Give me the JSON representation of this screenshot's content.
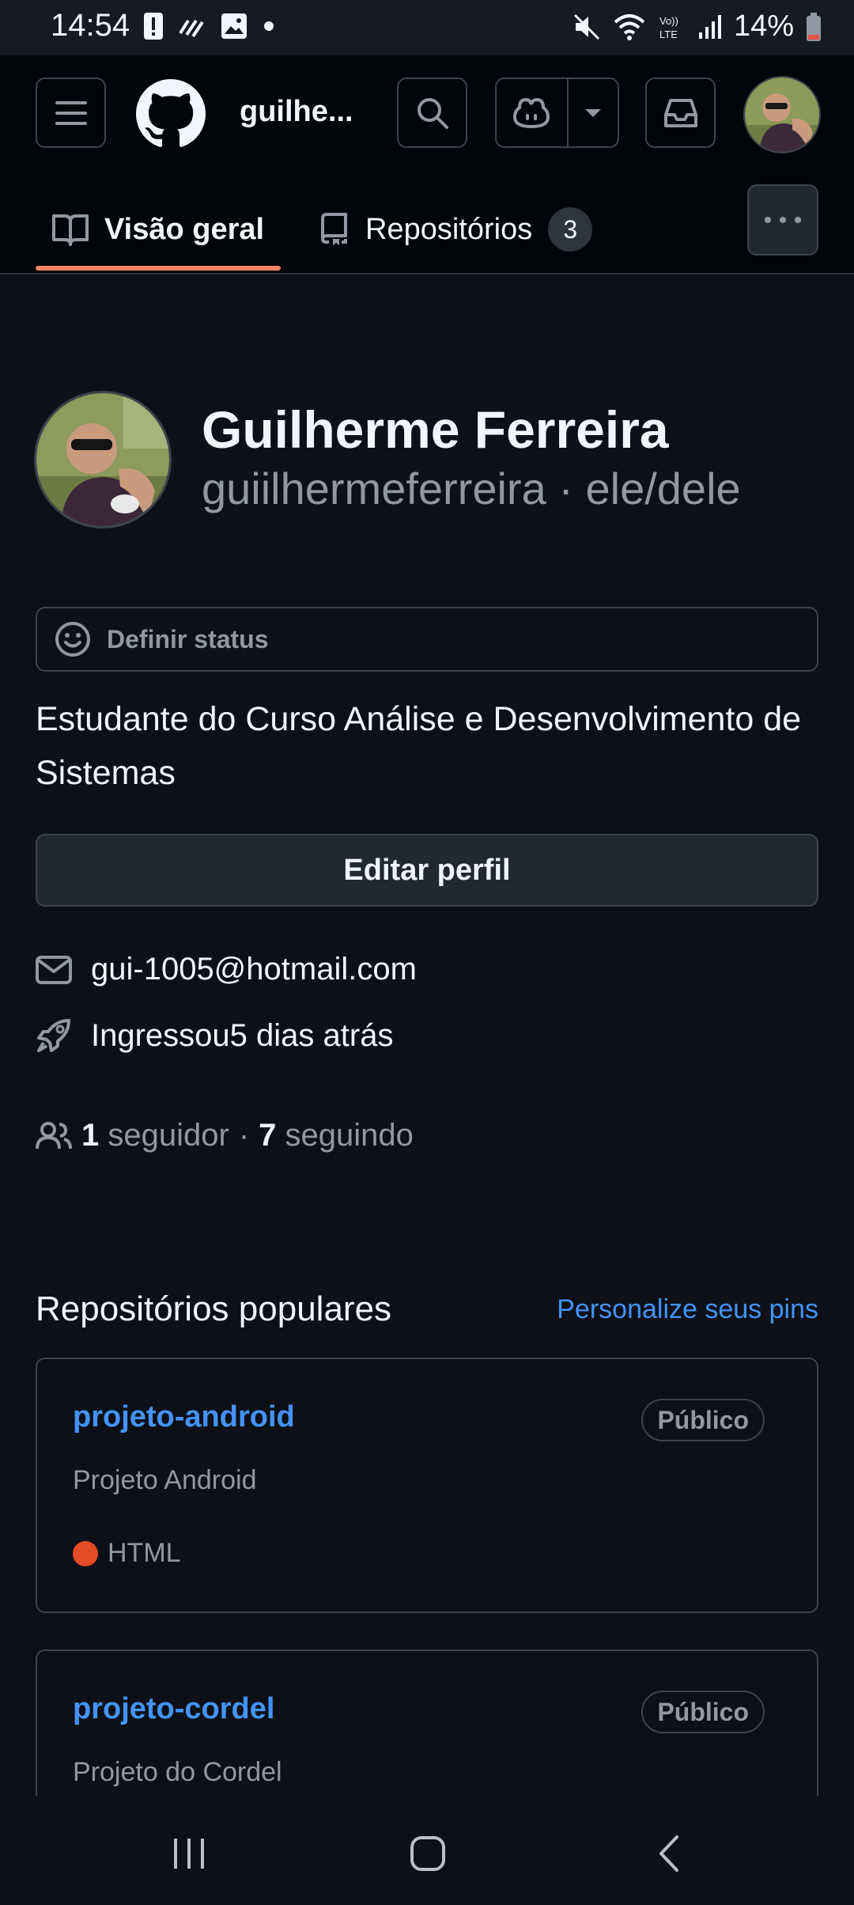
{
  "status_bar": {
    "time": "14:54",
    "battery": "14%",
    "icons": [
      "alert-icon",
      "signal-activity-icon",
      "image-icon",
      "dot-icon",
      "mute-icon",
      "wifi-icon",
      "volte-icon",
      "cell-signal-icon",
      "battery-icon"
    ]
  },
  "header": {
    "username_short": "guilhe...",
    "icons": [
      "menu-icon",
      "github-logo-icon",
      "search-icon",
      "copilot-icon",
      "caret-down-icon",
      "inbox-icon"
    ]
  },
  "tabs": [
    {
      "label": "Visão geral",
      "icon": "book-icon",
      "active": true
    },
    {
      "label": "Repositórios",
      "icon": "repo-icon",
      "count": "3"
    }
  ],
  "profile": {
    "name": "Guilherme Ferreira",
    "handle_line": "guiilhermeferreira · ele/dele",
    "status_placeholder": "Definir status",
    "bio": "Estudante do Curso Análise e Desenvolvimento de Sistemas",
    "edit_button": "Editar perfil",
    "email": "gui-1005@hotmail.com",
    "joined": "Ingressou5 dias atrás",
    "followers_count": "1",
    "followers_label": "seguidor",
    "separator": "·",
    "following_count": "7",
    "following_label": "seguindo"
  },
  "popular": {
    "title": "Repositórios populares",
    "customize_link": "Personalize seus pins",
    "repos": [
      {
        "name": "projeto-android",
        "visibility": "Público",
        "description": "Projeto Android",
        "language": "HTML",
        "language_color": "#e34c26"
      },
      {
        "name": "projeto-cordel",
        "visibility": "Público",
        "description": "Projeto do Cordel"
      }
    ]
  },
  "nav_bar": {
    "icons": [
      "recent-apps-icon",
      "home-icon",
      "back-icon"
    ]
  },
  "colors": {
    "background": "#0d1117",
    "accent_link": "#4493f8",
    "tab_underline": "#f78166"
  }
}
